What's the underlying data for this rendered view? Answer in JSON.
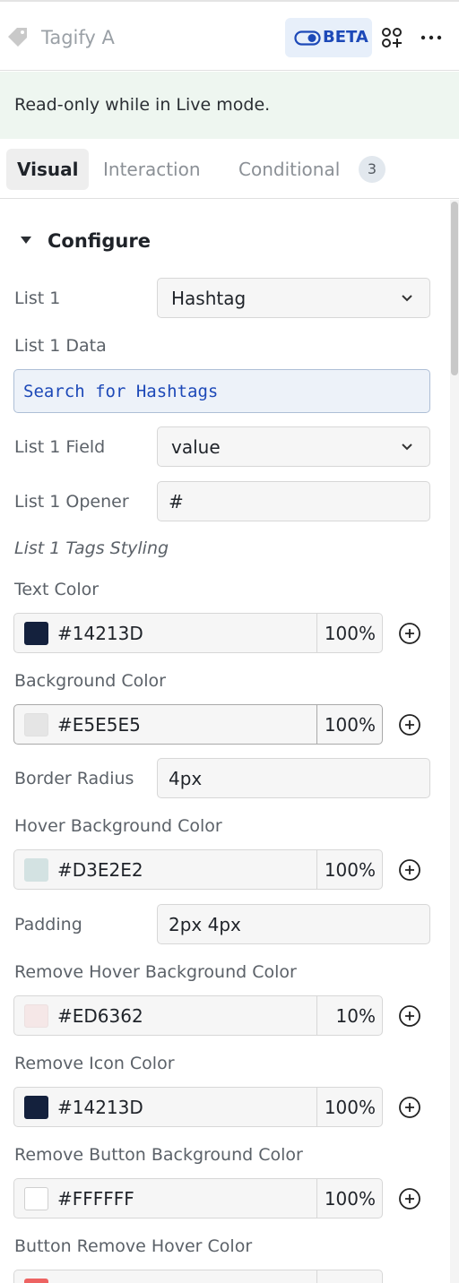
{
  "header": {
    "component_name": "Tagify A",
    "beta_label": "BETA",
    "icons": {
      "tag": "tag-icon",
      "toggle": "toggle-icon",
      "components": "components-icon",
      "more": "more-icon"
    }
  },
  "banner": {
    "text": "Read-only while in Live mode."
  },
  "tabs": [
    {
      "label": "Visual",
      "active": true
    },
    {
      "label": "Interaction",
      "active": false
    },
    {
      "label": "Conditional",
      "active": false,
      "badge": "3"
    }
  ],
  "section": {
    "title": "Configure"
  },
  "fields": {
    "list1": {
      "label": "List 1",
      "value": "Hashtag"
    },
    "list1_data": {
      "label": "List 1 Data",
      "value": "Search for Hashtags"
    },
    "list1_field": {
      "label": "List 1 Field",
      "value": "value"
    },
    "list1_opener": {
      "label": "List 1 Opener",
      "value": "#"
    },
    "tags_styling": {
      "label": "List 1 Tags Styling"
    },
    "text_color": {
      "label": "Text Color",
      "hex": "#14213D",
      "opacity": "100%",
      "swatch": "#14213D"
    },
    "background_color": {
      "label": "Background Color",
      "hex": "#E5E5E5",
      "opacity": "100%",
      "swatch": "#E5E5E5"
    },
    "border_radius": {
      "label": "Border Radius",
      "value": "4px"
    },
    "hover_background_color": {
      "label": "Hover Background Color",
      "hex": "#D3E2E2",
      "opacity": "100%",
      "swatch": "#D3E2E2"
    },
    "padding": {
      "label": "Padding",
      "value": "2px 4px"
    },
    "remove_hover_background_color": {
      "label": "Remove Hover Background Color",
      "hex": "#ED6362",
      "opacity": "10%",
      "swatch": "#F5E7E7"
    },
    "remove_icon_color": {
      "label": "Remove Icon Color",
      "hex": "#14213D",
      "opacity": "100%",
      "swatch": "#14213D"
    },
    "remove_button_background_color": {
      "label": "Remove Button Background Color",
      "hex": "#FFFFFF",
      "opacity": "100%",
      "swatch": "#FFFFFF"
    },
    "button_remove_hover_color": {
      "label": "Button Remove Hover Color",
      "swatch": "#ED6362"
    }
  },
  "colors": {
    "accent": "#1D49B8",
    "banner_bg": "#EEF6F0",
    "beta_bg": "#E7EFFA"
  }
}
